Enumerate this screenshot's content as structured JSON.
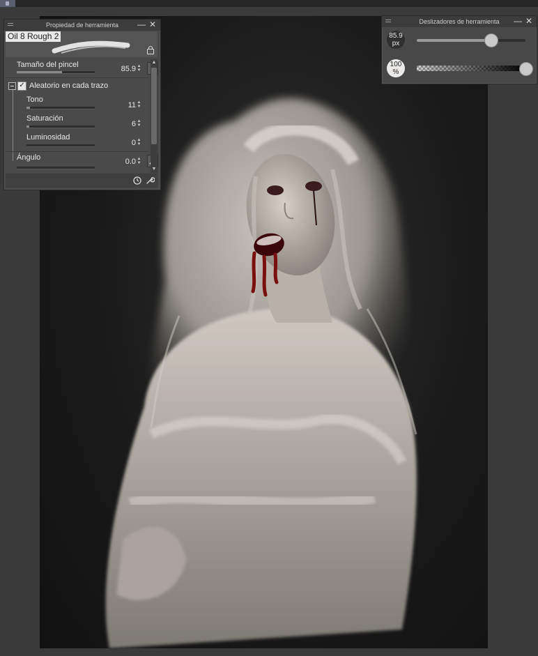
{
  "tool_property": {
    "title": "Propiedad de herramienta",
    "brush_name": "Oil 8 Rough 2",
    "brush_size": {
      "label": "Tamaño del pincel",
      "value": "85.9",
      "fraction": 0.58
    },
    "random_per_stroke": {
      "label": "Aleatorio en cada trazo",
      "checked": true
    },
    "hue": {
      "label": "Tono",
      "value": "11",
      "fraction": 0.05
    },
    "saturation": {
      "label": "Saturación",
      "value": "6",
      "fraction": 0.04
    },
    "luminosity": {
      "label": "Luminosidad",
      "value": "0",
      "fraction": 0.0
    },
    "angle": {
      "label": "Ángulo",
      "value": "0.0",
      "fraction": 0.0
    }
  },
  "tool_sliders": {
    "title": "Deslizadores de herramienta",
    "size": {
      "value": "85.9",
      "unit": "px",
      "fraction": 0.68
    },
    "opacity": {
      "value": "100",
      "unit": "%",
      "fraction": 1.0
    }
  },
  "icons": {
    "menu": "grip-icon",
    "minimize": "minimize-icon",
    "close": "close-icon",
    "lock": "lock-icon",
    "pressure": "pressure-icon",
    "angle": "angle-icon",
    "reset": "reset-icon",
    "settings": "wrench-icon"
  },
  "colors": {
    "panel": "#484848",
    "titlebar": "#3c3c3c",
    "canvas": "#1a1a1a",
    "blood": "#7a0f10"
  }
}
